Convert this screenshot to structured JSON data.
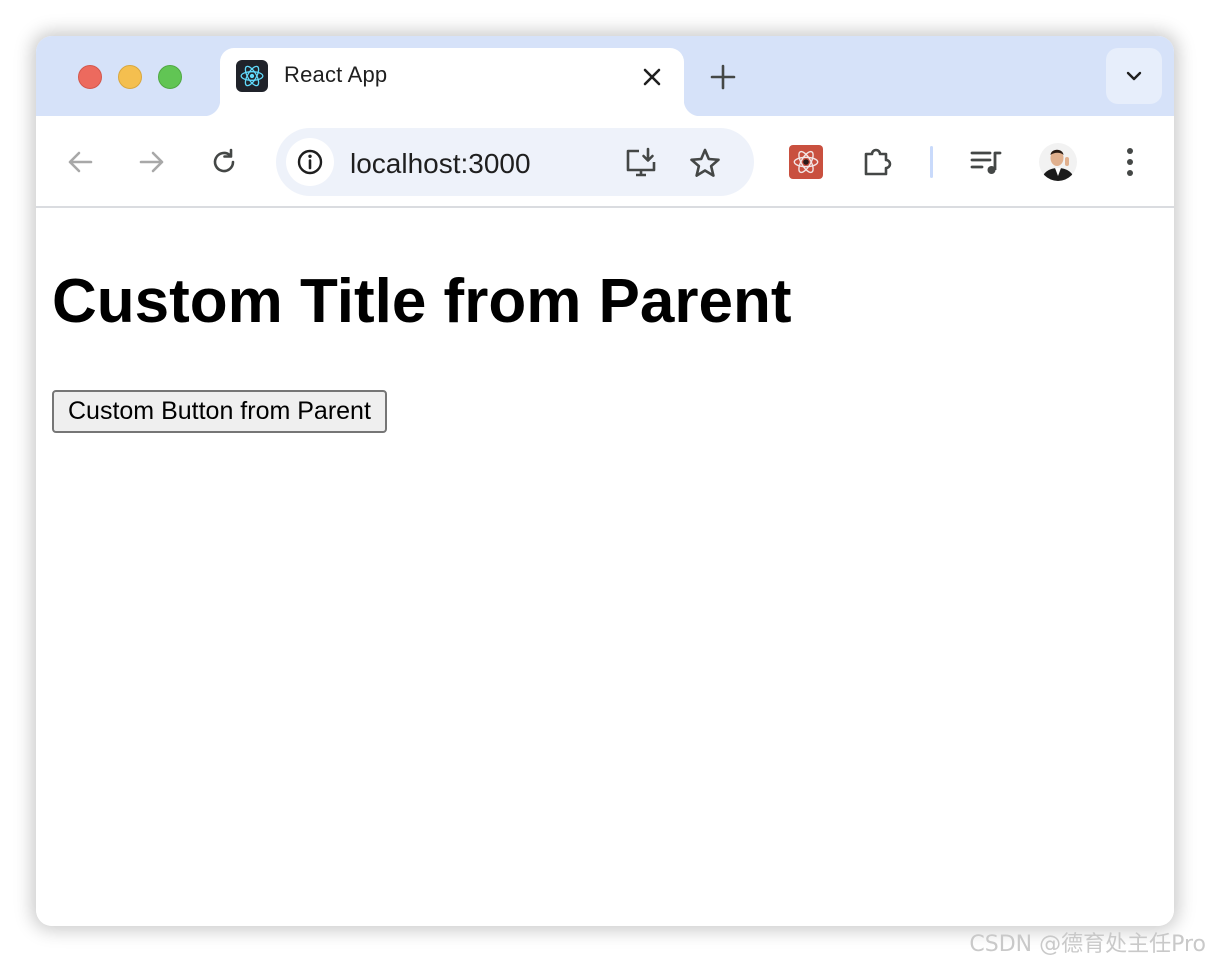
{
  "browser": {
    "tab": {
      "title": "React App",
      "favicon": "react-logo-icon"
    },
    "address_bar": {
      "url": "localhost:3000"
    },
    "icons": {
      "back": "arrow-left-icon",
      "forward": "arrow-right-icon",
      "reload": "reload-icon",
      "site_info": "info-icon",
      "install": "install-app-icon",
      "bookmark": "star-icon",
      "extension": "react-devtools-icon",
      "extensions": "puzzle-icon",
      "media": "media-queue-icon",
      "profile": "avatar",
      "menu": "kebab-menu-icon"
    },
    "colors": {
      "tabstrip": "#d6e2f9",
      "omnibox": "#eef2fa"
    }
  },
  "page": {
    "heading": "Custom Title from Parent",
    "button_label": "Custom Button from Parent"
  },
  "watermark": "CSDN @德育处主任Pro"
}
